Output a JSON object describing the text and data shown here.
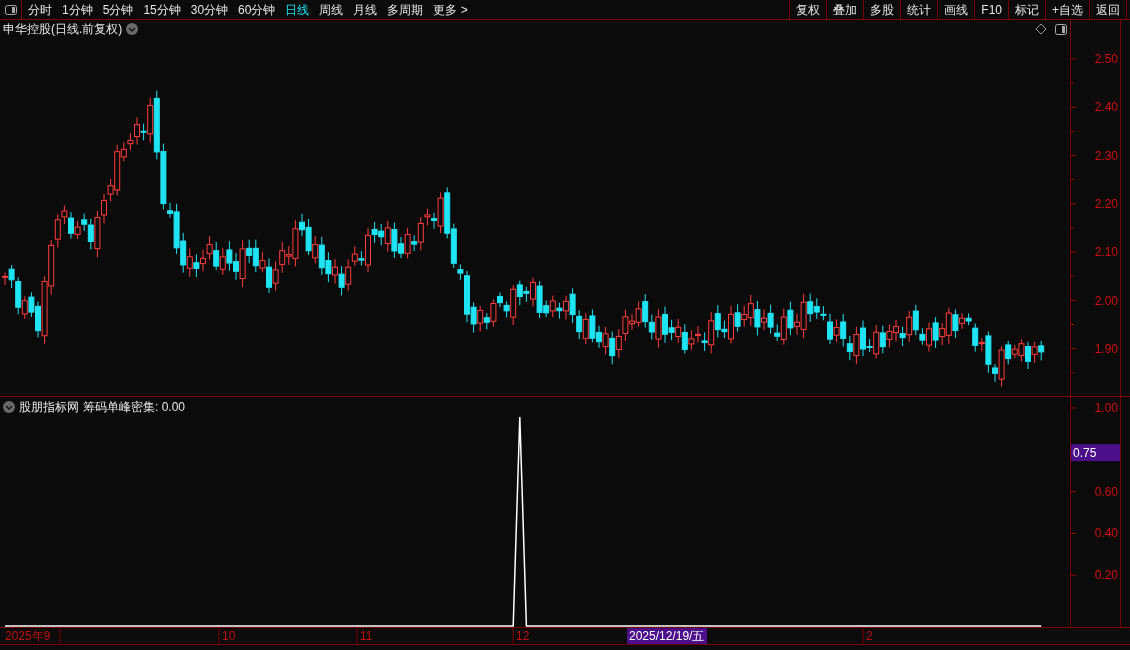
{
  "toolbar": {
    "periods": [
      {
        "label": "分时",
        "selected": false
      },
      {
        "label": "1分钟",
        "selected": false
      },
      {
        "label": "5分钟",
        "selected": false
      },
      {
        "label": "15分钟",
        "selected": false
      },
      {
        "label": "30分钟",
        "selected": false
      },
      {
        "label": "60分钟",
        "selected": false
      },
      {
        "label": "日线",
        "selected": true
      },
      {
        "label": "周线",
        "selected": false
      },
      {
        "label": "月线",
        "selected": false
      },
      {
        "label": "多周期",
        "selected": false
      }
    ],
    "more": "更多 >",
    "buttons": [
      "复权",
      "叠加",
      "多股",
      "统计",
      "画线",
      "F10",
      "标记",
      "+自选",
      "返回"
    ]
  },
  "main_chart": {
    "title": "申华控股(日线.前复权)",
    "yticks": [
      "2.50",
      "2.40",
      "2.30",
      "2.20",
      "2.10",
      "2.00",
      "1.90"
    ]
  },
  "indicator": {
    "source": "股朋指标网",
    "name": "筹码单峰密集: 0.00",
    "cursor_value": "0.75",
    "yticks": [
      "1.00",
      "0.60",
      "0.40",
      "0.20"
    ]
  },
  "date_axis": {
    "labels": [
      {
        "text": "2025年9"
      },
      {
        "text": "10"
      },
      {
        "text": "11"
      },
      {
        "text": "12"
      },
      {
        "text": "2"
      }
    ],
    "cursor_date": "2025/12/19/五"
  }
}
